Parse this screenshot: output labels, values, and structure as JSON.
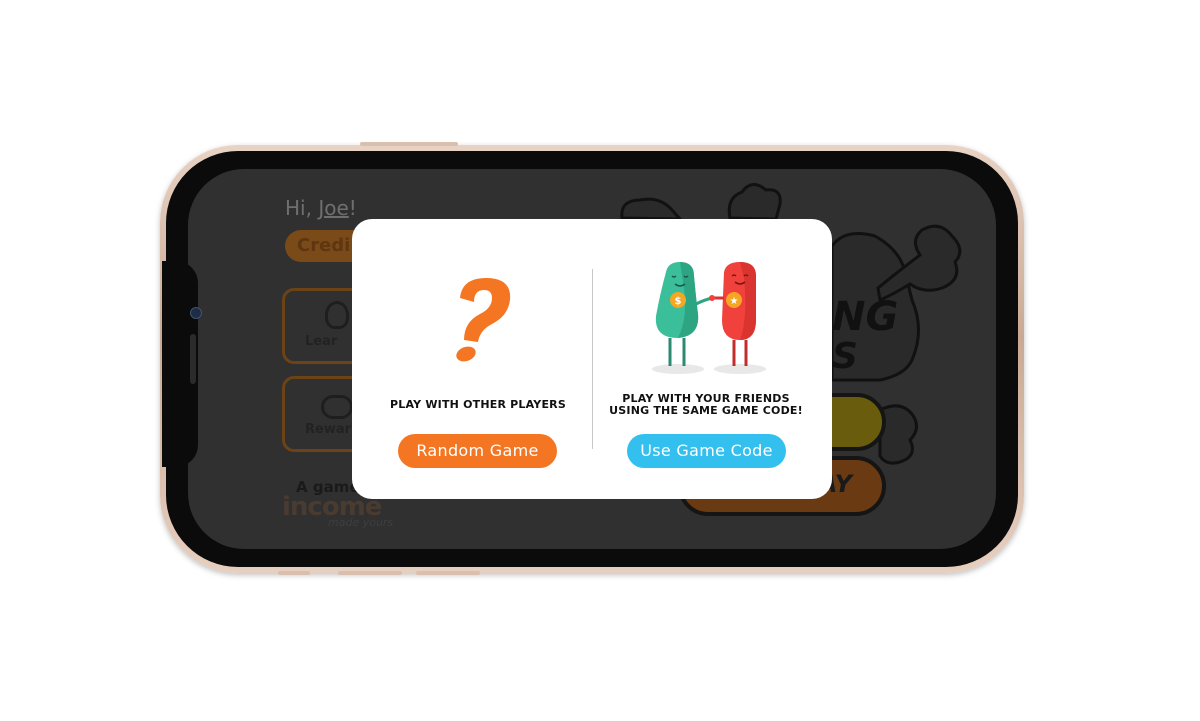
{
  "greeting": {
    "prefix": "Hi,",
    "name": "Joe",
    "suffix": "!"
  },
  "credits": {
    "label": "Credi"
  },
  "menu": [
    {
      "label": "Lear"
    },
    {
      "label": "Rewar"
    }
  ],
  "brand": {
    "prefix": "A game",
    "logo": "income",
    "tagline": "made yours"
  },
  "background_buttons": {
    "play_label": "AY"
  },
  "dialog": {
    "left": {
      "caption": "PLAY WITH OTHER PLAYERS",
      "button": "Random Game",
      "icon": "question-mark-icon"
    },
    "right": {
      "caption_line1": "PLAY WITH YOUR FRIENDS",
      "caption_line2": "USING THE SAME GAME CODE!",
      "button": "Use Game Code",
      "icon": "friends-illustration"
    }
  },
  "colors": {
    "primary_orange": "#f47622",
    "primary_blue": "#33c0ef",
    "overlay": "#303030"
  }
}
